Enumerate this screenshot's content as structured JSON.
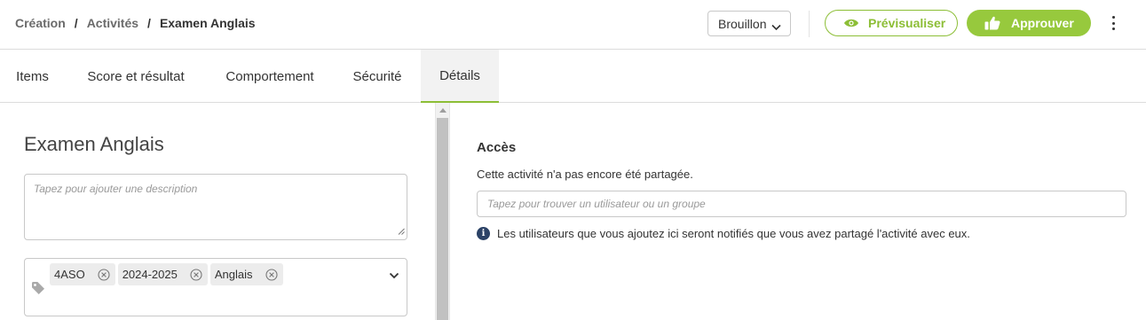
{
  "breadcrumb": {
    "items": [
      "Création",
      "Activités",
      "Examen Anglais"
    ],
    "separator": "/"
  },
  "header": {
    "status_value": "Brouillon",
    "preview_label": "Prévisualiser",
    "approve_label": "Approuver",
    "accent_color": "#97c93d"
  },
  "tabs": [
    {
      "label": "Items"
    },
    {
      "label": "Score et résultat"
    },
    {
      "label": "Comportement"
    },
    {
      "label": "Sécurité"
    },
    {
      "label": "Détails",
      "active": true
    }
  ],
  "details": {
    "title": "Examen Anglais",
    "description_placeholder": "Tapez pour ajouter une description",
    "tags": [
      "4ASO",
      "2024-2025",
      "Anglais"
    ]
  },
  "access": {
    "title": "Accès",
    "status_text": "Cette activité n'a pas encore été partagée.",
    "search_placeholder": "Tapez pour trouver un utilisateur ou un groupe",
    "info_text": "Les utilisateurs que vous ajoutez ici seront notifiés que vous avez partagé l'activité avec eux."
  }
}
